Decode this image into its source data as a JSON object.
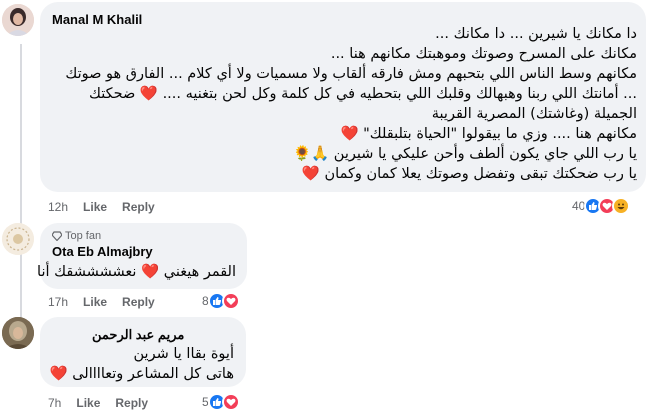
{
  "comments": [
    {
      "author": "Manal M Khalil",
      "lines": [
        "دا مكانك يا شيرين ... دا مكانك ...",
        "مكانك على المسرح وصوتك وموهبتك مكانهم هنا ...",
        "مكانهم وسط الناس اللي بتحبهم ومش فارقه ألقاب ولا مسميات ولا أي كلام ... الفارق هو صوتك",
        "... أمانتك اللي ربنا وهبهالك وقلبك اللي بتحطيه في كل كلمة وكل لحن بتغنيه .... ❤️ ضحكتك",
        "الجميلة (وغاشتك) المصرية القريبة",
        "مكانهم هنا .... وزي ما بيقولوا \"الحياة بتلبقلك\" ❤️",
        "يا رب اللي جاي يكون ألطف وأحن عليكي يا شيرين 🙏🌻",
        "يا رب ضحكتك تبقى وتفضل وصوتك يعلا كمان وكمان ❤️"
      ],
      "age": "12h",
      "like_label": "Like",
      "reply_label": "Reply",
      "reaction_count": "40",
      "reactions": [
        "like-icon",
        "love-icon",
        "haha-icon"
      ]
    },
    {
      "badge": "Top fan",
      "author": "Ota Eb Almajbry",
      "lines": [
        "القمر هيغني ❤️ نعششششقك أنا"
      ],
      "age": "17h",
      "like_label": "Like",
      "reply_label": "Reply",
      "reaction_count": "8",
      "reactions": [
        "like-icon",
        "love-icon"
      ]
    },
    {
      "author": "مريم عبد الرحمن",
      "lines": [
        "أيوة بقاا يا شرين",
        "هاتى كل المشاعر وتعاااالى ❤️"
      ],
      "age": "7h",
      "like_label": "Like",
      "reply_label": "Reply",
      "reaction_count": "5",
      "reactions": [
        "like-icon",
        "love-icon"
      ]
    }
  ],
  "colors": {
    "bubble": "#f0f2f5",
    "like": "#1877f2",
    "love": "#f33e58",
    "haha": "#f7b125",
    "meta": "#65676b"
  }
}
